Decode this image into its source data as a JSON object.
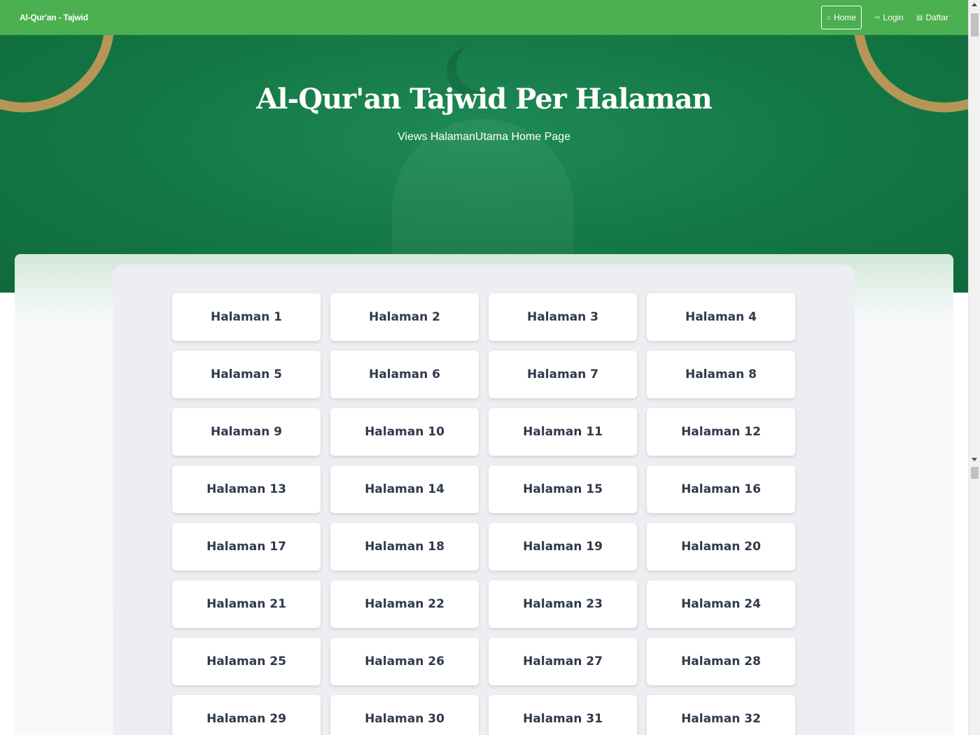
{
  "navbar": {
    "brand": "Al-Qur'an - Tajwid",
    "links": [
      {
        "label": "Home",
        "icon": "home-icon",
        "active": true
      },
      {
        "label": "Login",
        "icon": "login-icon",
        "active": false
      },
      {
        "label": "Daftar",
        "icon": "register-icon",
        "active": false
      }
    ]
  },
  "hero": {
    "title": "Al-Qur'an Tajwid Per Halaman",
    "subtitle": "Views HalamanUtama Home Page"
  },
  "pages": [
    "Halaman 1",
    "Halaman 2",
    "Halaman 3",
    "Halaman 4",
    "Halaman 5",
    "Halaman 6",
    "Halaman 7",
    "Halaman 8",
    "Halaman 9",
    "Halaman 10",
    "Halaman 11",
    "Halaman 12",
    "Halaman 13",
    "Halaman 14",
    "Halaman 15",
    "Halaman 16",
    "Halaman 17",
    "Halaman 18",
    "Halaman 19",
    "Halaman 20",
    "Halaman 21",
    "Halaman 22",
    "Halaman 23",
    "Halaman 24",
    "Halaman 25",
    "Halaman 26",
    "Halaman 27",
    "Halaman 28",
    "Halaman 29",
    "Halaman 30",
    "Halaman 31",
    "Halaman 32"
  ],
  "colors": {
    "navbar": "#4caf50",
    "hero": "#157a47",
    "button_text": "#2f3a4c"
  }
}
